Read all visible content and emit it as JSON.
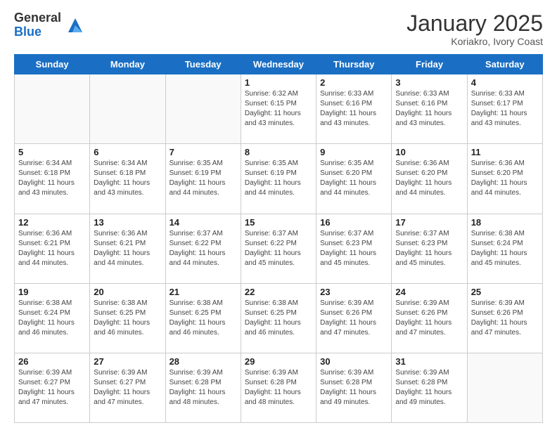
{
  "header": {
    "logo_general": "General",
    "logo_blue": "Blue",
    "month_title": "January 2025",
    "subtitle": "Koriakro, Ivory Coast"
  },
  "days_of_week": [
    "Sunday",
    "Monday",
    "Tuesday",
    "Wednesday",
    "Thursday",
    "Friday",
    "Saturday"
  ],
  "weeks": [
    [
      {
        "day": "",
        "sunrise": "",
        "sunset": "",
        "daylight": ""
      },
      {
        "day": "",
        "sunrise": "",
        "sunset": "",
        "daylight": ""
      },
      {
        "day": "",
        "sunrise": "",
        "sunset": "",
        "daylight": ""
      },
      {
        "day": "1",
        "sunrise": "Sunrise: 6:32 AM",
        "sunset": "Sunset: 6:15 PM",
        "daylight": "Daylight: 11 hours and 43 minutes."
      },
      {
        "day": "2",
        "sunrise": "Sunrise: 6:33 AM",
        "sunset": "Sunset: 6:16 PM",
        "daylight": "Daylight: 11 hours and 43 minutes."
      },
      {
        "day": "3",
        "sunrise": "Sunrise: 6:33 AM",
        "sunset": "Sunset: 6:16 PM",
        "daylight": "Daylight: 11 hours and 43 minutes."
      },
      {
        "day": "4",
        "sunrise": "Sunrise: 6:33 AM",
        "sunset": "Sunset: 6:17 PM",
        "daylight": "Daylight: 11 hours and 43 minutes."
      }
    ],
    [
      {
        "day": "5",
        "sunrise": "Sunrise: 6:34 AM",
        "sunset": "Sunset: 6:18 PM",
        "daylight": "Daylight: 11 hours and 43 minutes."
      },
      {
        "day": "6",
        "sunrise": "Sunrise: 6:34 AM",
        "sunset": "Sunset: 6:18 PM",
        "daylight": "Daylight: 11 hours and 43 minutes."
      },
      {
        "day": "7",
        "sunrise": "Sunrise: 6:35 AM",
        "sunset": "Sunset: 6:19 PM",
        "daylight": "Daylight: 11 hours and 44 minutes."
      },
      {
        "day": "8",
        "sunrise": "Sunrise: 6:35 AM",
        "sunset": "Sunset: 6:19 PM",
        "daylight": "Daylight: 11 hours and 44 minutes."
      },
      {
        "day": "9",
        "sunrise": "Sunrise: 6:35 AM",
        "sunset": "Sunset: 6:20 PM",
        "daylight": "Daylight: 11 hours and 44 minutes."
      },
      {
        "day": "10",
        "sunrise": "Sunrise: 6:36 AM",
        "sunset": "Sunset: 6:20 PM",
        "daylight": "Daylight: 11 hours and 44 minutes."
      },
      {
        "day": "11",
        "sunrise": "Sunrise: 6:36 AM",
        "sunset": "Sunset: 6:20 PM",
        "daylight": "Daylight: 11 hours and 44 minutes."
      }
    ],
    [
      {
        "day": "12",
        "sunrise": "Sunrise: 6:36 AM",
        "sunset": "Sunset: 6:21 PM",
        "daylight": "Daylight: 11 hours and 44 minutes."
      },
      {
        "day": "13",
        "sunrise": "Sunrise: 6:36 AM",
        "sunset": "Sunset: 6:21 PM",
        "daylight": "Daylight: 11 hours and 44 minutes."
      },
      {
        "day": "14",
        "sunrise": "Sunrise: 6:37 AM",
        "sunset": "Sunset: 6:22 PM",
        "daylight": "Daylight: 11 hours and 44 minutes."
      },
      {
        "day": "15",
        "sunrise": "Sunrise: 6:37 AM",
        "sunset": "Sunset: 6:22 PM",
        "daylight": "Daylight: 11 hours and 45 minutes."
      },
      {
        "day": "16",
        "sunrise": "Sunrise: 6:37 AM",
        "sunset": "Sunset: 6:23 PM",
        "daylight": "Daylight: 11 hours and 45 minutes."
      },
      {
        "day": "17",
        "sunrise": "Sunrise: 6:37 AM",
        "sunset": "Sunset: 6:23 PM",
        "daylight": "Daylight: 11 hours and 45 minutes."
      },
      {
        "day": "18",
        "sunrise": "Sunrise: 6:38 AM",
        "sunset": "Sunset: 6:24 PM",
        "daylight": "Daylight: 11 hours and 45 minutes."
      }
    ],
    [
      {
        "day": "19",
        "sunrise": "Sunrise: 6:38 AM",
        "sunset": "Sunset: 6:24 PM",
        "daylight": "Daylight: 11 hours and 46 minutes."
      },
      {
        "day": "20",
        "sunrise": "Sunrise: 6:38 AM",
        "sunset": "Sunset: 6:25 PM",
        "daylight": "Daylight: 11 hours and 46 minutes."
      },
      {
        "day": "21",
        "sunrise": "Sunrise: 6:38 AM",
        "sunset": "Sunset: 6:25 PM",
        "daylight": "Daylight: 11 hours and 46 minutes."
      },
      {
        "day": "22",
        "sunrise": "Sunrise: 6:38 AM",
        "sunset": "Sunset: 6:25 PM",
        "daylight": "Daylight: 11 hours and 46 minutes."
      },
      {
        "day": "23",
        "sunrise": "Sunrise: 6:39 AM",
        "sunset": "Sunset: 6:26 PM",
        "daylight": "Daylight: 11 hours and 47 minutes."
      },
      {
        "day": "24",
        "sunrise": "Sunrise: 6:39 AM",
        "sunset": "Sunset: 6:26 PM",
        "daylight": "Daylight: 11 hours and 47 minutes."
      },
      {
        "day": "25",
        "sunrise": "Sunrise: 6:39 AM",
        "sunset": "Sunset: 6:26 PM",
        "daylight": "Daylight: 11 hours and 47 minutes."
      }
    ],
    [
      {
        "day": "26",
        "sunrise": "Sunrise: 6:39 AM",
        "sunset": "Sunset: 6:27 PM",
        "daylight": "Daylight: 11 hours and 47 minutes."
      },
      {
        "day": "27",
        "sunrise": "Sunrise: 6:39 AM",
        "sunset": "Sunset: 6:27 PM",
        "daylight": "Daylight: 11 hours and 47 minutes."
      },
      {
        "day": "28",
        "sunrise": "Sunrise: 6:39 AM",
        "sunset": "Sunset: 6:28 PM",
        "daylight": "Daylight: 11 hours and 48 minutes."
      },
      {
        "day": "29",
        "sunrise": "Sunrise: 6:39 AM",
        "sunset": "Sunset: 6:28 PM",
        "daylight": "Daylight: 11 hours and 48 minutes."
      },
      {
        "day": "30",
        "sunrise": "Sunrise: 6:39 AM",
        "sunset": "Sunset: 6:28 PM",
        "daylight": "Daylight: 11 hours and 49 minutes."
      },
      {
        "day": "31",
        "sunrise": "Sunrise: 6:39 AM",
        "sunset": "Sunset: 6:28 PM",
        "daylight": "Daylight: 11 hours and 49 minutes."
      },
      {
        "day": "",
        "sunrise": "",
        "sunset": "",
        "daylight": ""
      }
    ]
  ]
}
